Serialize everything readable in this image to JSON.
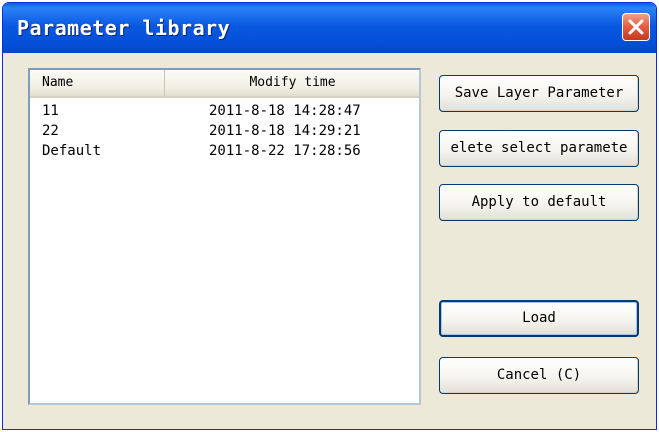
{
  "window": {
    "title": "Parameter library"
  },
  "titlebar": {
    "close_icon": "close-x-icon",
    "close_color": "#e35c3d",
    "bar_color": "#0a58e0"
  },
  "list": {
    "columns": [
      "Name",
      "Modify time"
    ],
    "rows": [
      {
        "name": "11",
        "modified": "2011-8-18 14:28:47"
      },
      {
        "name": "22",
        "modified": "2011-8-18 14:29:21"
      },
      {
        "name": "Default",
        "modified": "2011-8-22 17:28:56"
      }
    ]
  },
  "buttons": {
    "save_layer": "Save Layer Parameter",
    "delete_selected": "elete select paramete",
    "apply_default": "Apply to default",
    "load": "Load",
    "cancel": "Cancel (C)"
  }
}
